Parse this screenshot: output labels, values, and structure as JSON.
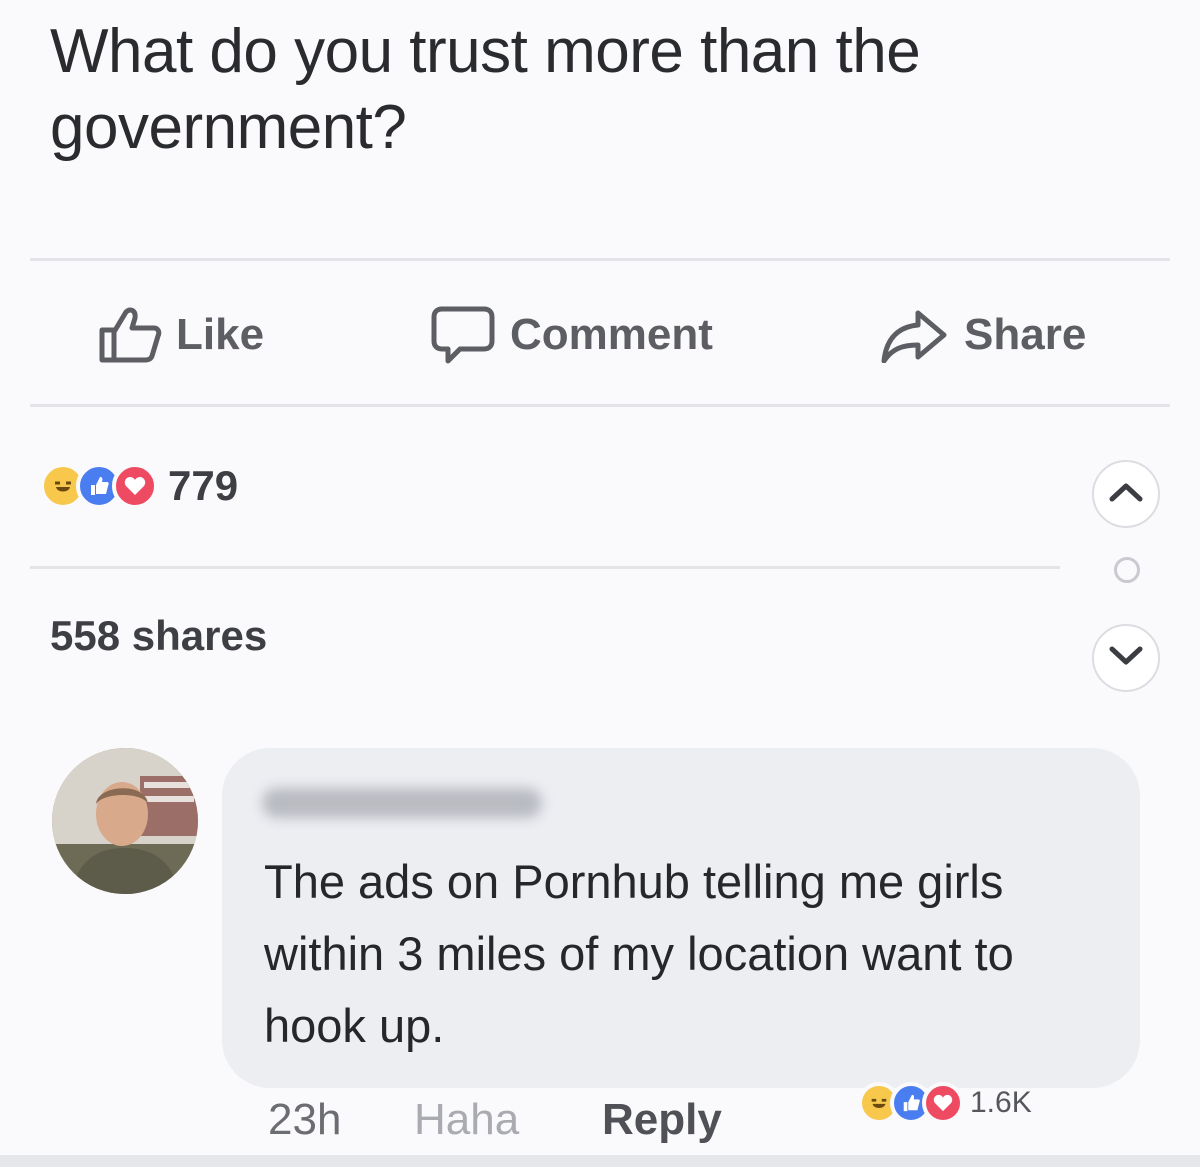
{
  "post": {
    "text": "What do you trust more than the government?"
  },
  "actions": {
    "like_label": "Like",
    "comment_label": "Comment",
    "share_label": "Share"
  },
  "stats": {
    "reactions_count": "779",
    "shares_text": "558 shares",
    "reaction_icons": [
      "haha",
      "like",
      "love"
    ]
  },
  "navigation": {
    "up_icon": "chevron-up-icon",
    "down_icon": "chevron-down-icon",
    "indicator_icon": "circle-icon"
  },
  "comment": {
    "text": "The ads on Pornhub telling me girls within 3 miles of my location want to hook up.",
    "time": "23h",
    "haha_label": "Haha",
    "reply_label": "Reply",
    "reactions_count": "1.6K",
    "reaction_icons": [
      "haha",
      "like",
      "love"
    ]
  },
  "colors": {
    "haha": "#f7c84b",
    "like": "#4a7df0",
    "love": "#ee4a62",
    "action_text": "#5c5e63"
  }
}
